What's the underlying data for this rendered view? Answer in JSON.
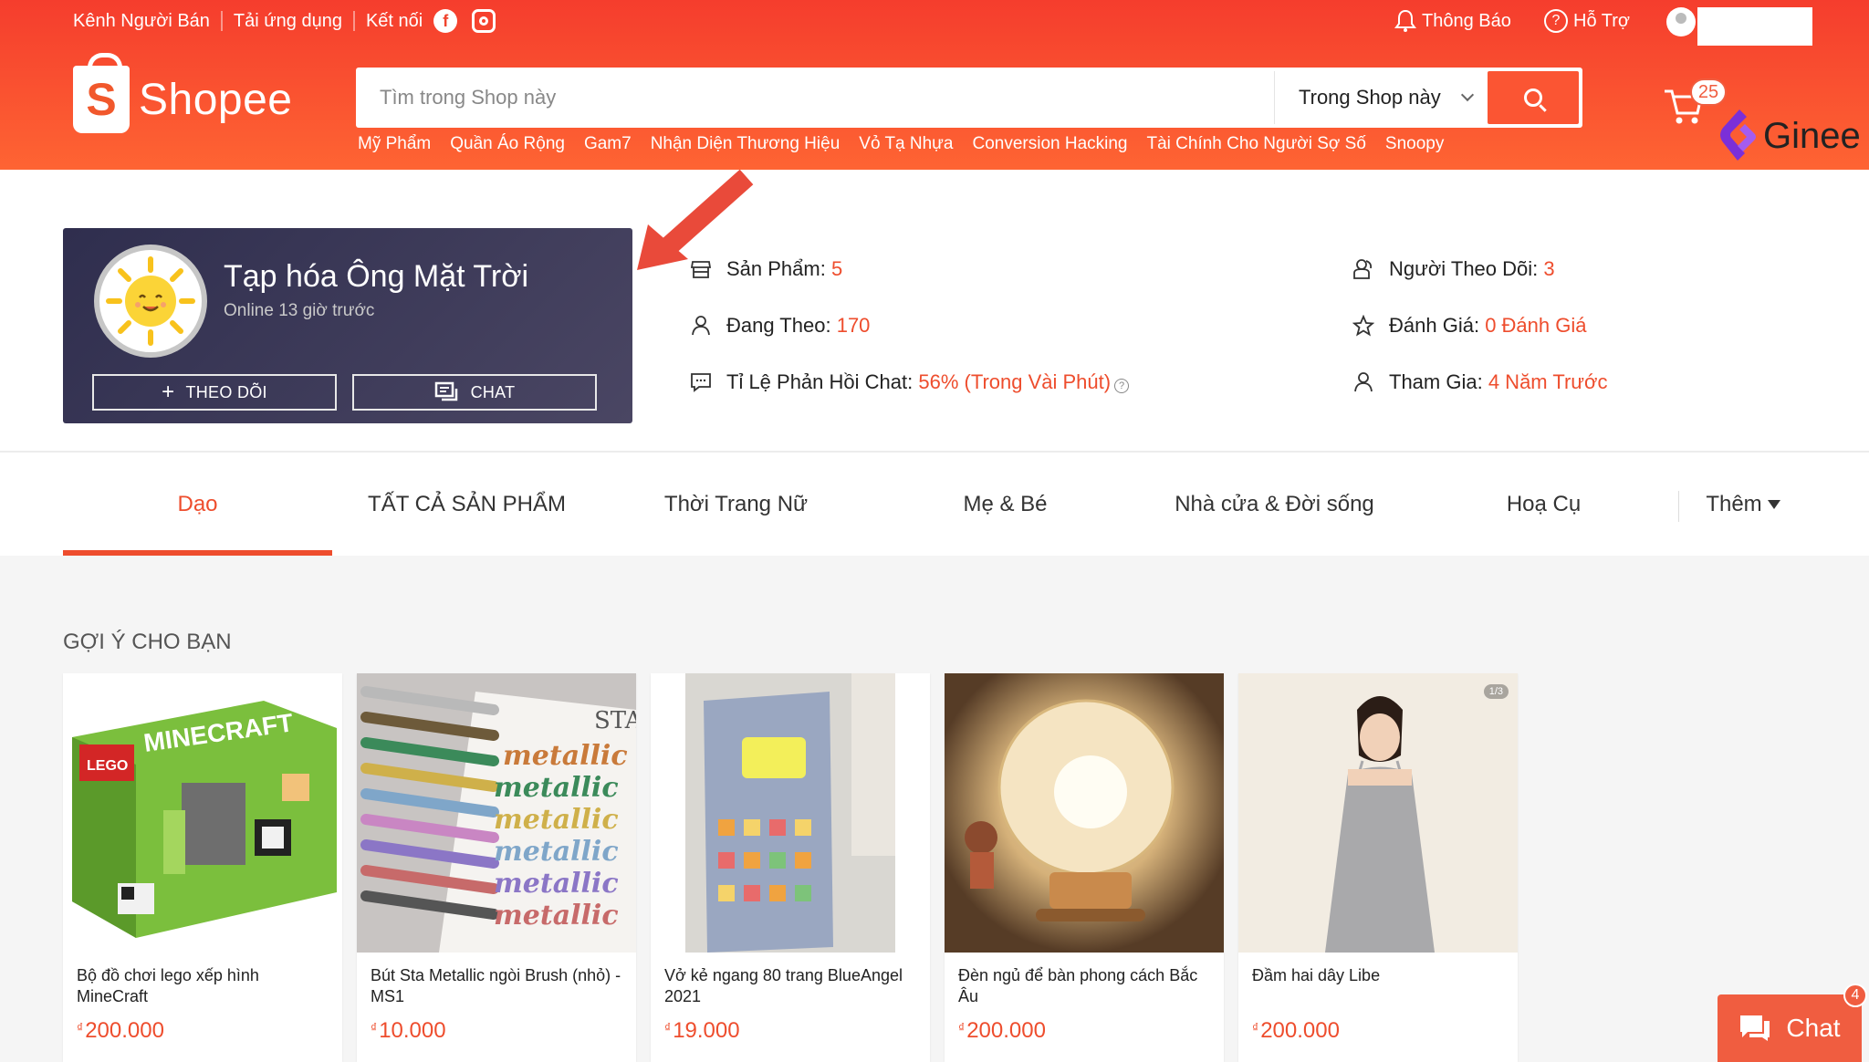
{
  "topbar": {
    "seller_channel": "Kênh Người Bán",
    "download_app": "Tải ứng dụng",
    "connect": "Kết nối",
    "notifications": "Thông Báo",
    "support": "Hỗ Trợ"
  },
  "logo": {
    "text": "Shopee"
  },
  "search": {
    "placeholder": "Tìm trong Shop này",
    "scope": "Trong Shop này"
  },
  "hotwords": [
    "Mỹ Phẩm",
    "Quần Áo Rộng",
    "Gam7",
    "Nhận Diện Thương Hiệu",
    "Vỏ Tạ Nhựa",
    "Conversion Hacking",
    "Tài Chính Cho Người Sợ Số",
    "Snoopy"
  ],
  "cart": {
    "count": "25"
  },
  "watermark": {
    "text": "Ginee"
  },
  "shop": {
    "name": "Tạp hóa Ông Mặt Trời",
    "online": "Online 13 giờ trước",
    "follow_button": "THEO DÕI",
    "chat_button": "CHAT"
  },
  "stats": {
    "products": {
      "label": "Sản Phẩm:",
      "value": "5"
    },
    "following": {
      "label": "Đang Theo:",
      "value": "170"
    },
    "chat_rate": {
      "label": "Tỉ Lệ Phản Hồi Chat:",
      "value": "56% (Trong Vài Phút)"
    },
    "followers": {
      "label": "Người Theo Dõi:",
      "value": "3"
    },
    "rating": {
      "label": "Đánh Giá:",
      "value": "0 Đánh Giá"
    },
    "joined": {
      "label": "Tham Gia:",
      "value": "4 Năm Trước"
    }
  },
  "tabs": [
    "Dạo",
    "TẤT CẢ SẢN PHẨM",
    "Thời Trang Nữ",
    "Mẹ & Bé",
    "Nhà cửa & Đời sống",
    "Hoạ Cụ",
    "Thêm"
  ],
  "recommend": {
    "title": "GỢI Ý CHO BẠN",
    "currency": "₫",
    "products": [
      {
        "name": "Bộ đồ chơi lego xếp hình MineCraft",
        "price": "200.000"
      },
      {
        "name": "Bút Sta Metallic ngòi Brush (nhỏ) - MS1",
        "price": "10.000"
      },
      {
        "name": "Vở kẻ ngang 80 trang BlueAngel 2021",
        "price": "19.000"
      },
      {
        "name": "Đèn ngủ để bàn phong cách Bắc Âu",
        "price": "200.000"
      },
      {
        "name": "Đầm hai dây Libe",
        "price": "200.000",
        "counter": "1/3"
      }
    ]
  },
  "chat_widget": {
    "label": "Chat",
    "badge": "4"
  },
  "colors": {
    "brand": "#ee4d2d",
    "header_top": "#f53d2d",
    "header_bottom": "#fe6433"
  }
}
